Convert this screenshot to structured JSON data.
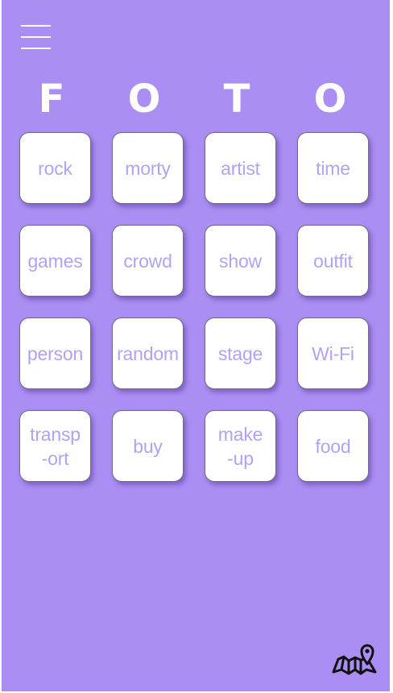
{
  "header": {
    "menu_icon": "hamburger-menu-icon",
    "title_letters": [
      "F",
      "O",
      "T",
      "O"
    ]
  },
  "tiles": [
    "rock",
    "morty",
    "artist",
    "time",
    "games",
    "crowd",
    "show",
    "outfit",
    "person",
    "random",
    "stage",
    "Wi-Fi",
    "transp\n-ort",
    "buy",
    "make\n-up",
    "food"
  ],
  "footer": {
    "map_icon": "map-pin-icon"
  },
  "colors": {
    "background": "#aa8ef3",
    "tile": "#ffffff",
    "tile_text": "#b3a2f4",
    "title": "#ffffff"
  }
}
